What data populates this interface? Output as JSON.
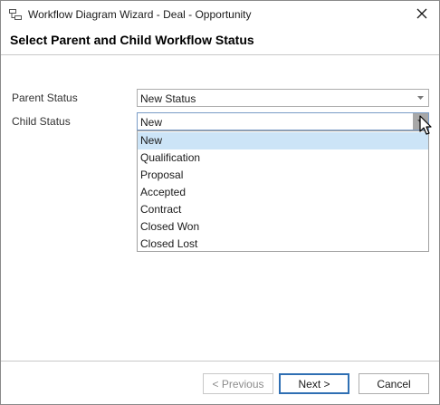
{
  "window": {
    "title": "Workflow Diagram Wizard - Deal - Opportunity"
  },
  "heading": "Select Parent and Child Workflow Status",
  "parent_status": {
    "label": "Parent Status",
    "value": "New Status"
  },
  "child_status": {
    "label": "Child Status",
    "value": "New",
    "options": [
      "New",
      "Qualification",
      "Proposal",
      "Accepted",
      "Contract",
      "Closed Won",
      "Closed Lost"
    ],
    "highlighted": "New"
  },
  "buttons": {
    "previous": "< Previous",
    "next": "Next >",
    "cancel": "Cancel"
  },
  "colors": {
    "selection": "#cce4f7",
    "primary_border": "#2f6fb3"
  }
}
